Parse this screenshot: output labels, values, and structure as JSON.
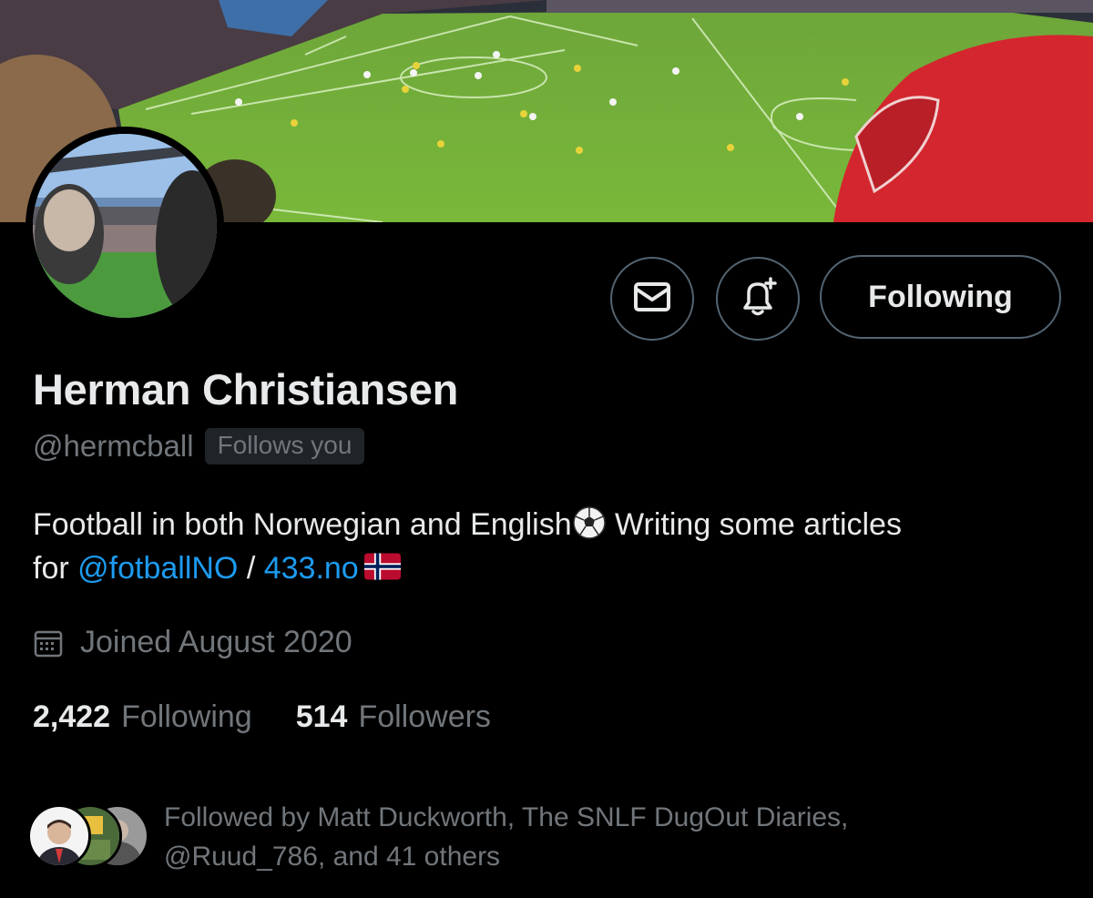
{
  "profile": {
    "name": "Herman Christiansen",
    "handle": "@hermcball",
    "follows_you": "Follows you"
  },
  "actions": {
    "message_icon": "mail-icon",
    "notify_icon": "bell-plus-icon",
    "following_label": "Following"
  },
  "bio": {
    "text_1": "Football in both Norwegian and English",
    "text_2": " Writing some articles",
    "text_3": "for ",
    "mention": "@fotballNO",
    "separator": " / ",
    "link": "433.no"
  },
  "joined": {
    "icon": "calendar-icon",
    "text": "Joined August 2020"
  },
  "stats": {
    "following_count": "2,422",
    "following_label": "Following",
    "followers_count": "514",
    "followers_label": "Followers"
  },
  "followed_by": {
    "line_1": "Followed by Matt Duckworth, The SNLF DugOut Diaries,",
    "line_2": "@Ruud_786, and 41 others"
  },
  "colors": {
    "background": "#000000",
    "link": "#1d9bf0",
    "secondary_text": "#71767b",
    "border": "#536471"
  }
}
